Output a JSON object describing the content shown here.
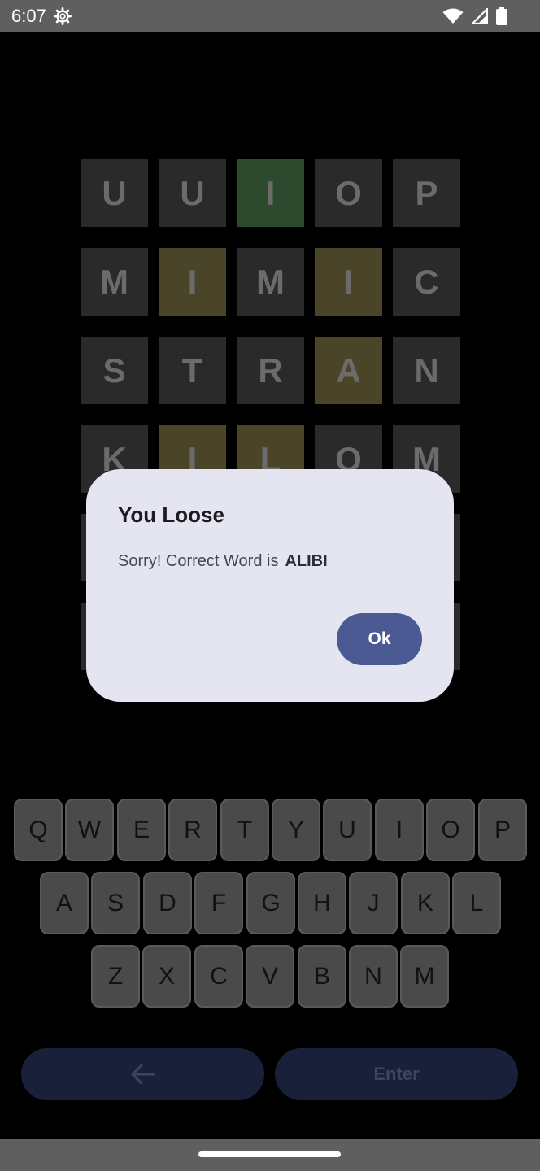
{
  "status_bar": {
    "time": "6:07",
    "icons": [
      "settings-gear-icon",
      "wifi-icon",
      "signal-icon",
      "battery-icon"
    ]
  },
  "board": {
    "rows": [
      [
        {
          "l": "U",
          "s": "absent"
        },
        {
          "l": "U",
          "s": "absent"
        },
        {
          "l": "I",
          "s": "correct"
        },
        {
          "l": "O",
          "s": "absent"
        },
        {
          "l": "P",
          "s": "absent"
        }
      ],
      [
        {
          "l": "M",
          "s": "absent"
        },
        {
          "l": "I",
          "s": "present"
        },
        {
          "l": "M",
          "s": "absent"
        },
        {
          "l": "I",
          "s": "present"
        },
        {
          "l": "C",
          "s": "absent"
        }
      ],
      [
        {
          "l": "S",
          "s": "absent"
        },
        {
          "l": "T",
          "s": "absent"
        },
        {
          "l": "R",
          "s": "absent"
        },
        {
          "l": "A",
          "s": "present"
        },
        {
          "l": "N",
          "s": "absent"
        }
      ],
      [
        {
          "l": "K",
          "s": "absent"
        },
        {
          "l": "I",
          "s": "present"
        },
        {
          "l": "L",
          "s": "present"
        },
        {
          "l": "O",
          "s": "absent"
        },
        {
          "l": "M",
          "s": "absent"
        }
      ],
      [
        {
          "l": "",
          "s": "absent"
        },
        {
          "l": "",
          "s": "absent"
        },
        {
          "l": "",
          "s": "absent"
        },
        {
          "l": "",
          "s": "absent"
        },
        {
          "l": "",
          "s": "absent"
        }
      ],
      [
        {
          "l": "",
          "s": "absent"
        },
        {
          "l": "",
          "s": "absent"
        },
        {
          "l": "",
          "s": "absent"
        },
        {
          "l": "",
          "s": "absent"
        },
        {
          "l": "",
          "s": "absent"
        }
      ]
    ],
    "colors": {
      "absent": "#2a2a2a",
      "correct": "#2e4a2e",
      "present": "#4a4428"
    }
  },
  "dialog": {
    "title": "You Loose",
    "message": "Sorry! Correct Word is",
    "word": "ALIBI",
    "ok_label": "Ok"
  },
  "keyboard": {
    "rows": [
      [
        "Q",
        "W",
        "E",
        "R",
        "T",
        "Y",
        "U",
        "I",
        "O",
        "P"
      ],
      [
        "A",
        "S",
        "D",
        "F",
        "G",
        "H",
        "J",
        "K",
        "L"
      ],
      [
        "Z",
        "X",
        "C",
        "V",
        "B",
        "N",
        "M"
      ]
    ]
  },
  "actions": {
    "back_icon": "arrow-left-icon",
    "enter_label": "Enter"
  },
  "accent_color": "#4b5a92"
}
